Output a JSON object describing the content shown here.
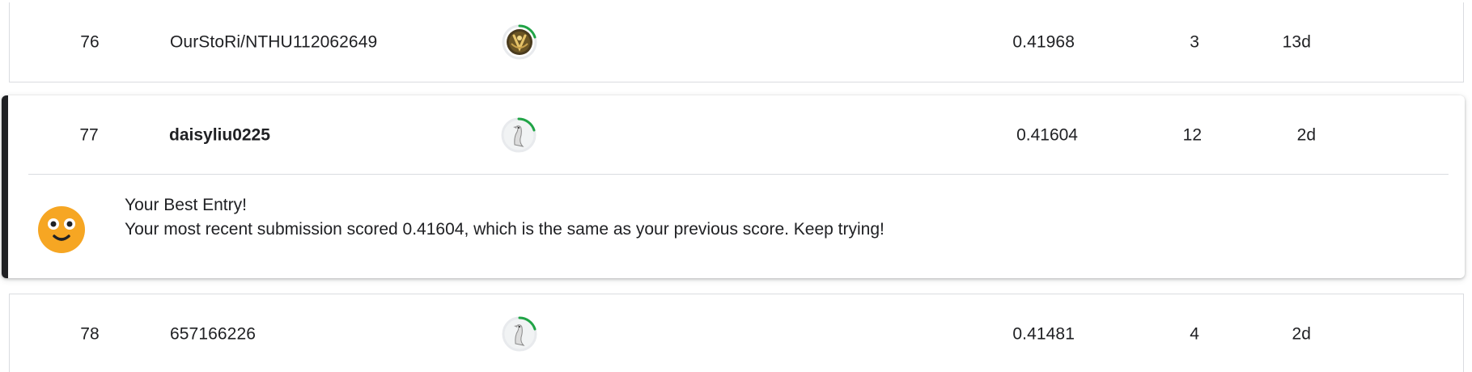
{
  "rows": [
    {
      "rank": "76",
      "team": "OurStoRi/NTHU112062649",
      "avatar_icon": "avatar-golden-emblem-icon",
      "score": "0.41968",
      "entries": "3",
      "last": "13d"
    },
    {
      "rank": "77",
      "team": "daisyliu0225",
      "avatar_icon": "avatar-goose-icon",
      "score": "0.41604",
      "entries": "12",
      "last": "2d"
    },
    {
      "rank": "78",
      "team": "657166226",
      "avatar_icon": "avatar-goose-icon",
      "score": "0.41481",
      "entries": "4",
      "last": "2d"
    }
  ],
  "best_entry": {
    "title": "Your Best Entry!",
    "message": "Your most recent submission scored 0.41604, which is the same as your previous score. Keep trying!",
    "emoji_icon": "smiley-face-icon"
  },
  "colors": {
    "accent_bar": "#202124",
    "progress_ring": "#20a446",
    "emoji_face": "#f6a623",
    "border": "#dadce0"
  }
}
